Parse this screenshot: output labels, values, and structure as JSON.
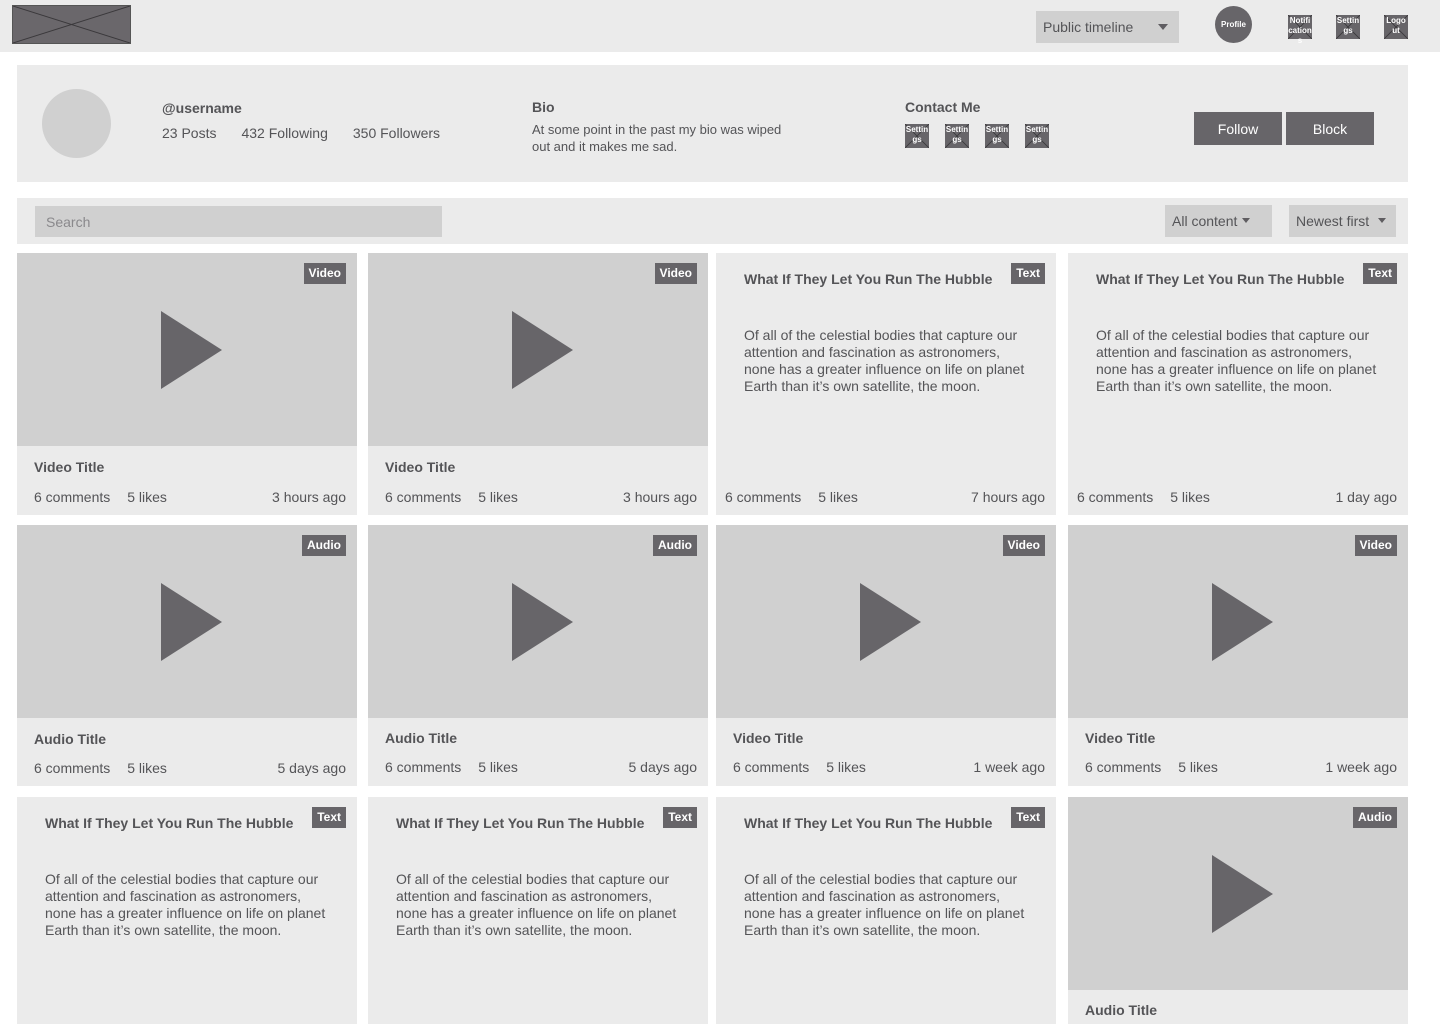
{
  "topbar": {
    "timeline_select": "Public timeline",
    "profile": "Profile",
    "icons": [
      {
        "label": "Notifications",
        "icon": "notifications-icon"
      },
      {
        "label": "Settings",
        "icon": "settings-icon"
      },
      {
        "label": "Logout",
        "icon": "logout-icon"
      }
    ]
  },
  "profile": {
    "username": "@username",
    "posts": "23 Posts",
    "following": "432 Following",
    "followers": "350 Followers",
    "bio_label": "Bio",
    "bio_text": "At some point in the past my bio was wiped out and it makes me sad.",
    "contact_label": "Contact Me",
    "contact_icons": [
      "Settings",
      "Settings",
      "Settings",
      "Settings"
    ],
    "follow_label": "Follow",
    "block_label": "Block"
  },
  "filters": {
    "search_placeholder": "Search",
    "content_filter": "All content",
    "sort_filter": "Newest first"
  },
  "cards": [
    {
      "type": "media",
      "badge": "Video",
      "title": "Video Title",
      "comments": "6 comments",
      "likes": "5 likes",
      "ago": "3 hours ago"
    },
    {
      "type": "media",
      "badge": "Video",
      "title": "Video Title",
      "comments": "6 comments",
      "likes": "5 likes",
      "ago": "3 hours ago"
    },
    {
      "type": "text",
      "badge": "Text",
      "title": "What If They Let You Run The Hubble",
      "body": "Of all of the celestial bodies that capture our attention and fascination as astronomers, none has a greater influence on life on planet Earth than it’s own satellite, the moon.",
      "comments": "6 comments",
      "likes": "5 likes",
      "ago": "7 hours ago"
    },
    {
      "type": "text",
      "badge": "Text",
      "title": "What If They Let You Run The Hubble",
      "body": "Of all of the celestial bodies that capture our attention and fascination as astronomers, none has a greater influence on life on planet Earth than it’s own satellite, the moon.",
      "comments": "6 comments",
      "likes": "5 likes",
      "ago": "1 day ago"
    },
    {
      "type": "media",
      "badge": "Audio",
      "title": "Audio Title",
      "comments": "6 comments",
      "likes": "5 likes",
      "ago": "5 days ago"
    },
    {
      "type": "media",
      "badge": "Audio",
      "title": "Audio Title",
      "comments": "6 comments",
      "likes": "5 likes",
      "ago": "5 days ago"
    },
    {
      "type": "media",
      "badge": "Video",
      "title": "Video Title",
      "comments": "6 comments",
      "likes": "5 likes",
      "ago": "1 week ago"
    },
    {
      "type": "media",
      "badge": "Video",
      "title": "Video Title",
      "comments": "6 comments",
      "likes": "5 likes",
      "ago": "1 week ago"
    },
    {
      "type": "text",
      "badge": "Text",
      "title": "What If They Let You Run The Hubble",
      "body": "Of all of the celestial bodies that capture our attention and fascination as astronomers, none has a greater influence on life on planet Earth than it’s own satellite, the moon."
    },
    {
      "type": "text",
      "badge": "Text",
      "title": "What If They Let You Run The Hubble",
      "body": "Of all of the celestial bodies that capture our attention and fascination as astronomers, none has a greater influence on life on planet Earth than it’s own satellite, the moon."
    },
    {
      "type": "text",
      "badge": "Text",
      "title": "What If They Let You Run The Hubble",
      "body": "Of all of the celestial bodies that capture our attention and fascination as astronomers, none has a greater influence on life on planet Earth than it’s own satellite, the moon."
    },
    {
      "type": "media",
      "badge": "Audio",
      "title": "Audio Title"
    }
  ]
}
